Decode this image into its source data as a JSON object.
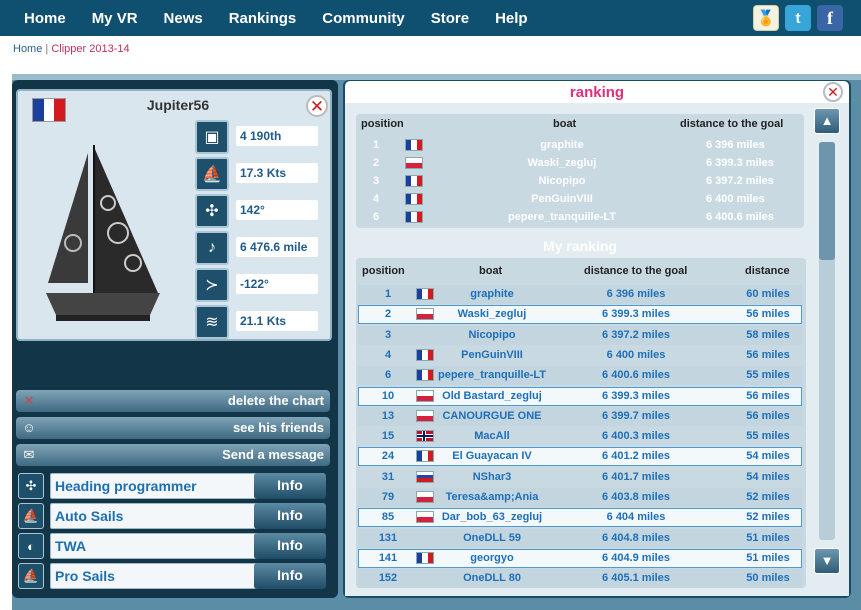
{
  "nav": {
    "items": [
      "Home",
      "My VR",
      "News",
      "Rankings",
      "Community",
      "Store",
      "Help"
    ],
    "social": [
      {
        "name": "award-icon",
        "glyph": "🏅"
      },
      {
        "name": "twitter-icon",
        "glyph": "t"
      },
      {
        "name": "facebook-icon",
        "glyph": "f"
      }
    ]
  },
  "breadcrumb": {
    "home": "Home",
    "separator": "|",
    "current": "Clipper 2013-14"
  },
  "boat": {
    "name": "Jupiter56",
    "flag": [
      "#1a3f9c",
      "#ffffff",
      "#d21a20"
    ],
    "stats": [
      {
        "icon": "podium-icon",
        "value": "4 190th"
      },
      {
        "icon": "speed-icon",
        "value": "17.3 Kts"
      },
      {
        "icon": "heading-icon",
        "value": "142°"
      },
      {
        "icon": "distance-icon",
        "value": "6 476.6 mile"
      },
      {
        "icon": "wind-angle-icon",
        "value": "-122°"
      },
      {
        "icon": "wind-speed-icon",
        "value": "21.1 Kts"
      }
    ]
  },
  "actions": [
    {
      "icon": "delete-icon",
      "label": "delete the chart"
    },
    {
      "icon": "friends-icon",
      "label": "see his friends"
    },
    {
      "icon": "message-icon",
      "label": "Send a message"
    }
  ],
  "options": [
    {
      "icon": "heading-programmer-icon",
      "label": "Heading programmer",
      "button": "Info"
    },
    {
      "icon": "auto-sails-icon",
      "label": "Auto Sails",
      "button": "Info"
    },
    {
      "icon": "twa-icon",
      "label": "TWA",
      "button": "Info"
    },
    {
      "icon": "pro-sails-icon",
      "label": "Pro Sails",
      "button": "Info"
    }
  ],
  "ranking": {
    "title": "ranking",
    "top_headers": {
      "position": "position",
      "boat": "boat",
      "distance": "distance to the goal"
    },
    "top": [
      {
        "pos": "1",
        "flag": "fr",
        "boat": "graphite",
        "dist": "6 396 miles"
      },
      {
        "pos": "2",
        "flag": "pl",
        "boat": "Waski_zegluj",
        "dist": "6 399.3 miles"
      },
      {
        "pos": "3",
        "flag": "fr",
        "boat": "Nicopipo",
        "dist": "6 397.2 miles"
      },
      {
        "pos": "4",
        "flag": "fr",
        "boat": "PenGuinVIII",
        "dist": "6 400 miles"
      },
      {
        "pos": "6",
        "flag": "fr",
        "boat": "pepere_tranquille-LT",
        "dist": "6 400.6 miles"
      }
    ],
    "my_title": "My ranking",
    "my_headers": {
      "position": "position",
      "boat": "boat",
      "distance_goal": "distance to the goal",
      "distance": "distance"
    },
    "mine": [
      {
        "pos": "1",
        "flag": "fr",
        "boat": "graphite",
        "dist": "6 396 miles",
        "d": "60 miles",
        "style": "alt"
      },
      {
        "pos": "2",
        "flag": "pl",
        "boat": "Waski_zegluj",
        "dist": "6 399.3 miles",
        "d": "56 miles",
        "style": "hl"
      },
      {
        "pos": "3",
        "flag": "",
        "boat": "Nicopipo",
        "dist": "6 397.2 miles",
        "d": "58 miles",
        "style": "alt"
      },
      {
        "pos": "4",
        "flag": "fr",
        "boat": "PenGuinVIII",
        "dist": "6 400 miles",
        "d": "56 miles",
        "style": ""
      },
      {
        "pos": "6",
        "flag": "fr",
        "boat": "pepere_tranquille-LT",
        "dist": "6 400.6 miles",
        "d": "55 miles",
        "style": "alt"
      },
      {
        "pos": "10",
        "flag": "pl",
        "boat": "Old Bastard_zegluj",
        "dist": "6 399.3 miles",
        "d": "56 miles",
        "style": "hl"
      },
      {
        "pos": "13",
        "flag": "pl",
        "boat": "CANOURGUE ONE",
        "dist": "6 399.7 miles",
        "d": "56 miles",
        "style": "alt"
      },
      {
        "pos": "15",
        "flag": "no",
        "boat": "MacAll",
        "dist": "6 400.3 miles",
        "d": "55 miles",
        "style": ""
      },
      {
        "pos": "24",
        "flag": "fr",
        "boat": "El Guayacan IV",
        "dist": "6 401.2 miles",
        "d": "54 miles",
        "style": "hl"
      },
      {
        "pos": "31",
        "flag": "ru",
        "boat": "NShar3",
        "dist": "6 401.7 miles",
        "d": "54 miles",
        "style": ""
      },
      {
        "pos": "79",
        "flag": "pl",
        "boat": "Teresa&amp;Ania",
        "dist": "6 403.8 miles",
        "d": "52 miles",
        "style": "alt"
      },
      {
        "pos": "85",
        "flag": "pl",
        "boat": "Dar_bob_63_zegluj",
        "dist": "6 404 miles",
        "d": "52 miles",
        "style": "hl"
      },
      {
        "pos": "131",
        "flag": "",
        "boat": "OneDLL 59",
        "dist": "6 404.8 miles",
        "d": "51 miles",
        "style": "alt"
      },
      {
        "pos": "141",
        "flag": "fr",
        "boat": "georgyo",
        "dist": "6 404.9 miles",
        "d": "51 miles",
        "style": "hl"
      },
      {
        "pos": "152",
        "flag": "",
        "boat": "OneDLL 80",
        "dist": "6 405.1 miles",
        "d": "50 miles",
        "style": "alt"
      }
    ]
  },
  "scroll": {
    "up": "▲",
    "down": "▼"
  },
  "colors": {
    "accent_pink": "#e0307a",
    "link_blue": "#1e6fb8",
    "nav_bg": "#0f4f6f"
  }
}
